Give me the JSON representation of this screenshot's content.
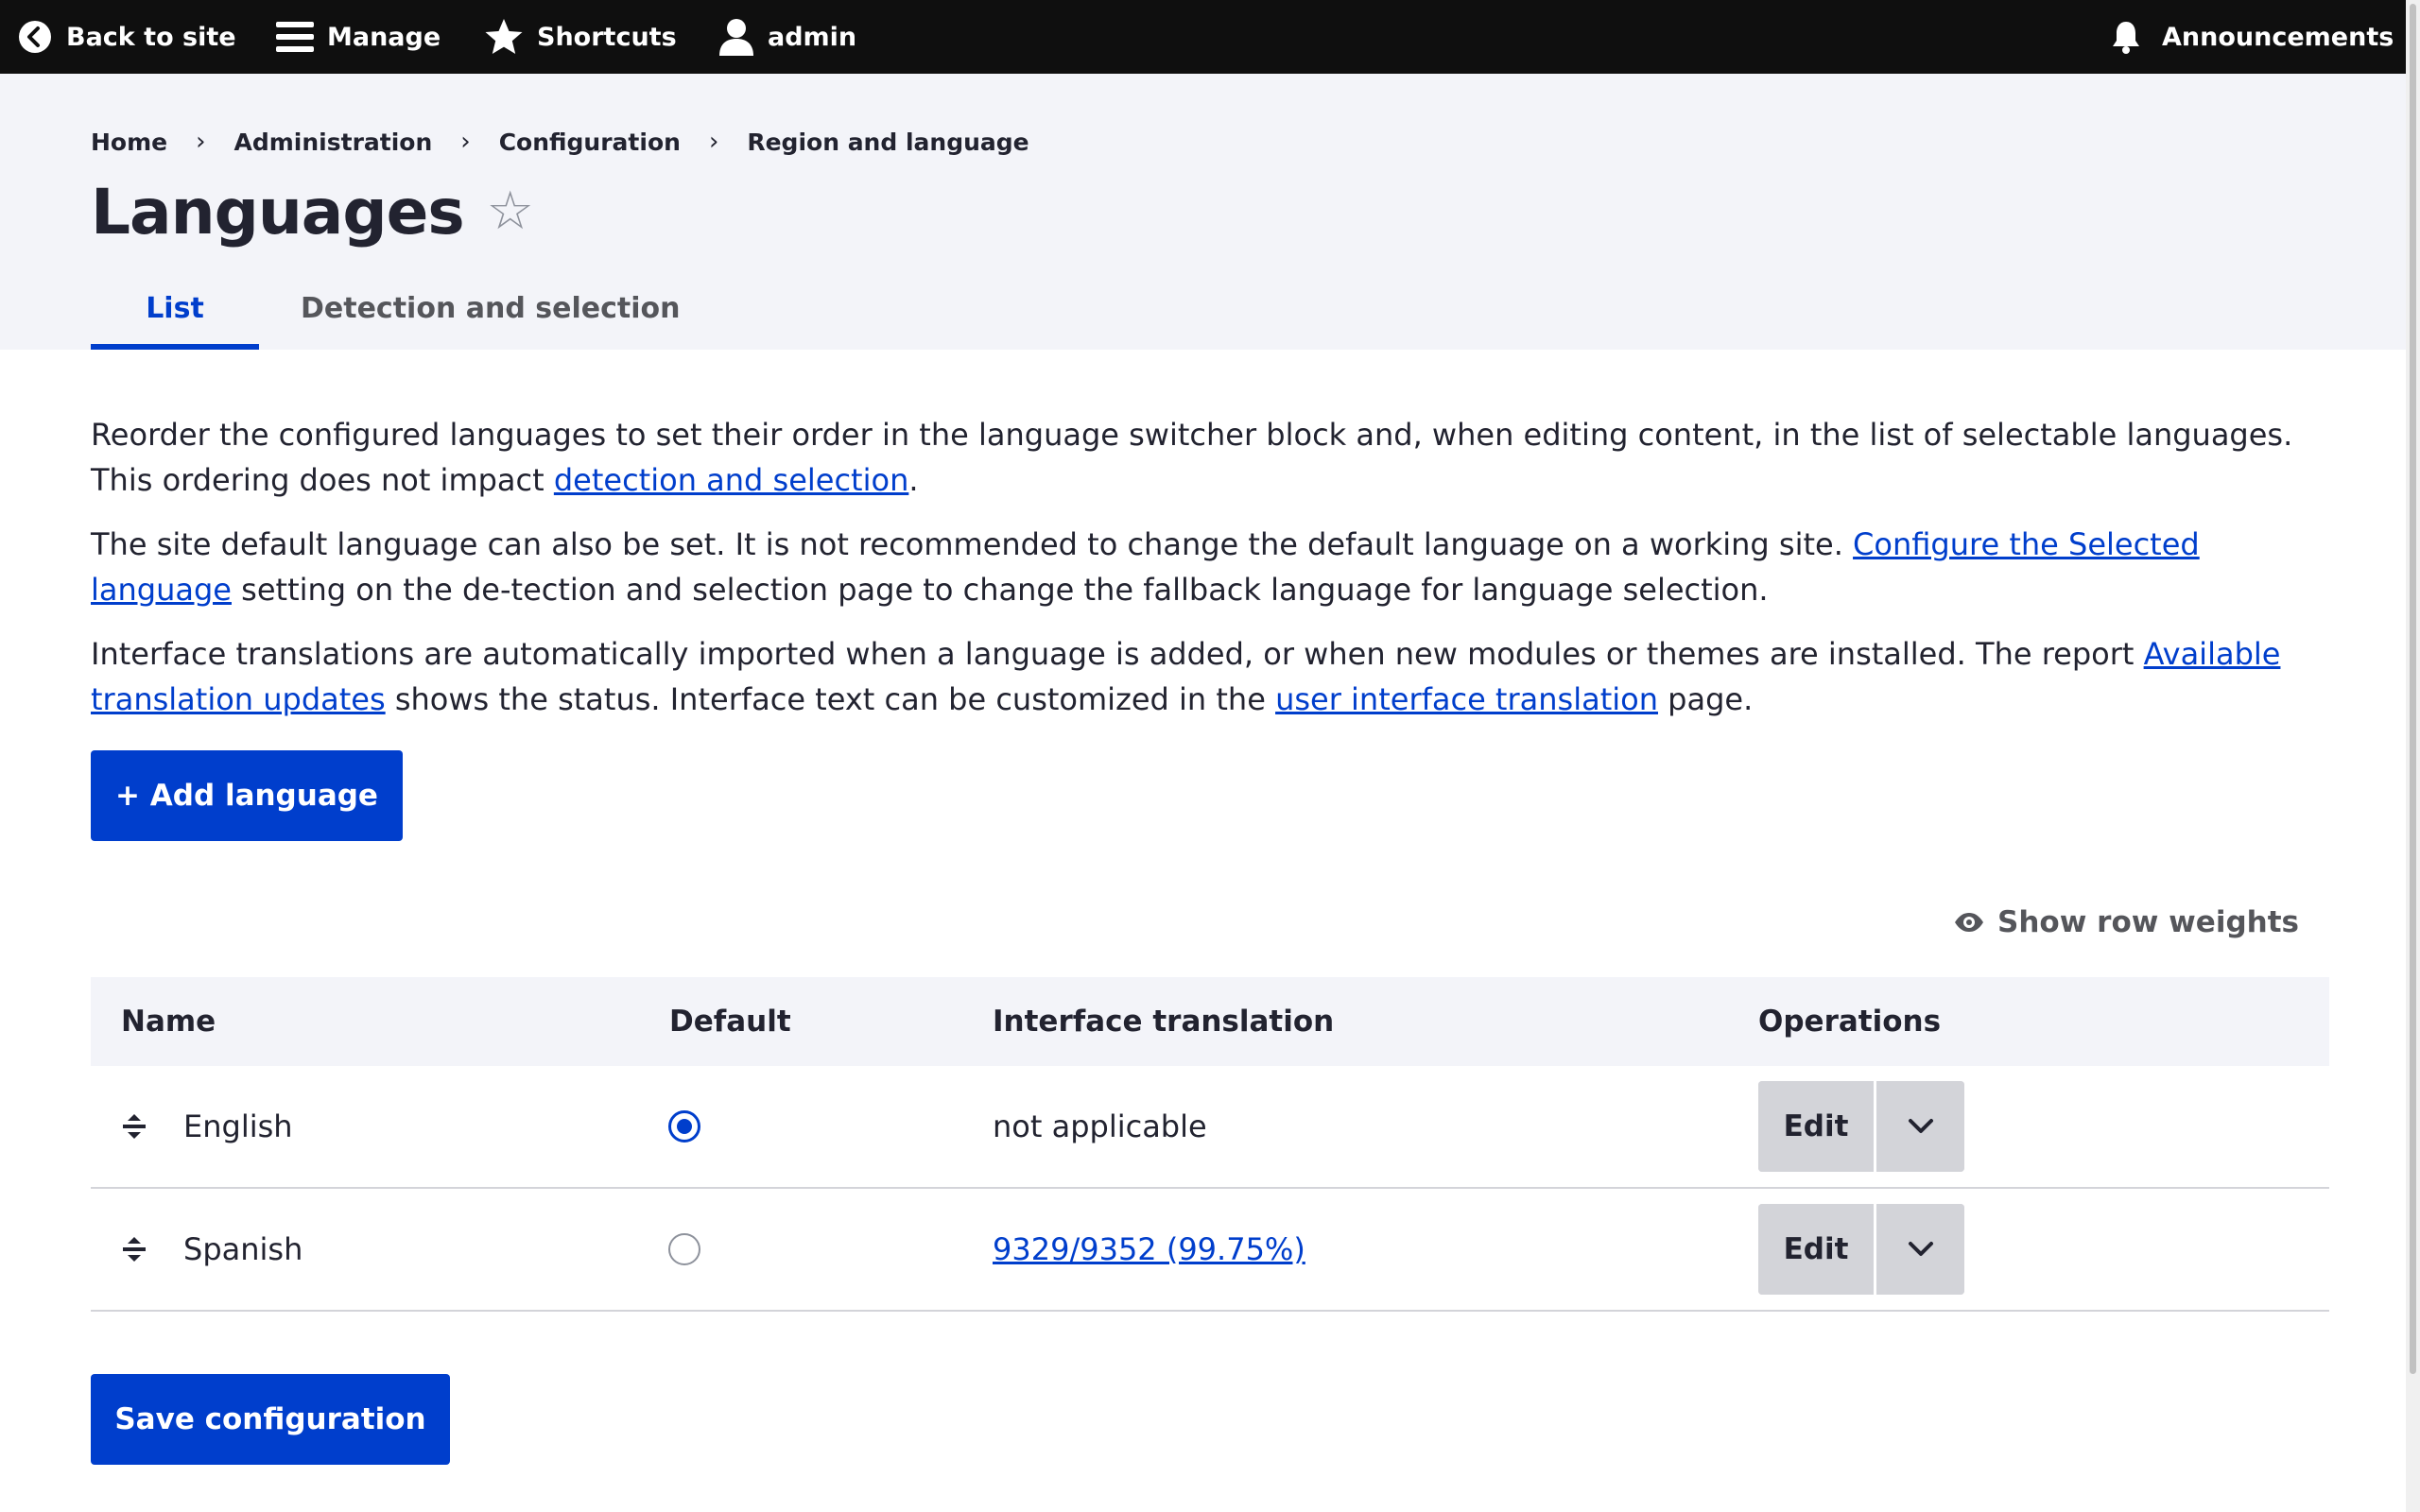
{
  "toolbar": {
    "back": "Back to site",
    "manage": "Manage",
    "shortcuts": "Shortcuts",
    "user": "admin",
    "announcements": "Announcements"
  },
  "breadcrumb": {
    "items": [
      "Home",
      "Administration",
      "Configuration",
      "Region and language"
    ],
    "separator": "›"
  },
  "page": {
    "title": "Languages",
    "favorite_icon": "☆"
  },
  "tabs": [
    {
      "label": "List",
      "active": true
    },
    {
      "label": "Detection and selection",
      "active": false
    }
  ],
  "description": {
    "p1_text": "Reorder the configured languages to set their order in the language switcher block and, when editing content, in the list of selectable languages. This ordering does not impact ",
    "p1_link": "detection and selection",
    "p1_end": ".",
    "p2_text": "The site default language can also be set. It is not recommended to change the default language on a working site. ",
    "p2_link": "Configure the Selected language",
    "p2_end": " setting on the de-tection and selection page to change the fallback language for language selection.",
    "p3_text": "Interface translations are automatically imported when a language is added, or when new modules or themes are installed. The report ",
    "p3_link": "Available translation updates",
    "p3_mid": " shows the status. Interface text can be customized in the ",
    "p3_link2": "user interface translation",
    "p3_end": " page."
  },
  "actions": {
    "add_language": "+ Add language",
    "show_row_weights": "Show row weights",
    "save": "Save configuration"
  },
  "table": {
    "headers": {
      "name": "Name",
      "default": "Default",
      "translation": "Interface translation",
      "operations": "Operations"
    },
    "rows": [
      {
        "name": "English",
        "default": true,
        "translation": "not applicable",
        "translation_link": false,
        "edit": "Edit"
      },
      {
        "name": "Spanish",
        "default": false,
        "translation": "9329/9352 (99.75%)",
        "translation_link": true,
        "edit": "Edit"
      }
    ]
  },
  "colors": {
    "accent": "#003ecc",
    "toolbar_bg": "#0f0f0f",
    "header_bg": "#f3f4f9"
  },
  "icons": {
    "back": "back-circle-icon",
    "manage": "hamburger-icon",
    "shortcuts": "star-icon",
    "user": "user-icon",
    "announcements": "bell-icon",
    "row_weights": "eye-icon",
    "drag": "drag-handle-icon",
    "dropdown": "chevron-down-icon"
  }
}
